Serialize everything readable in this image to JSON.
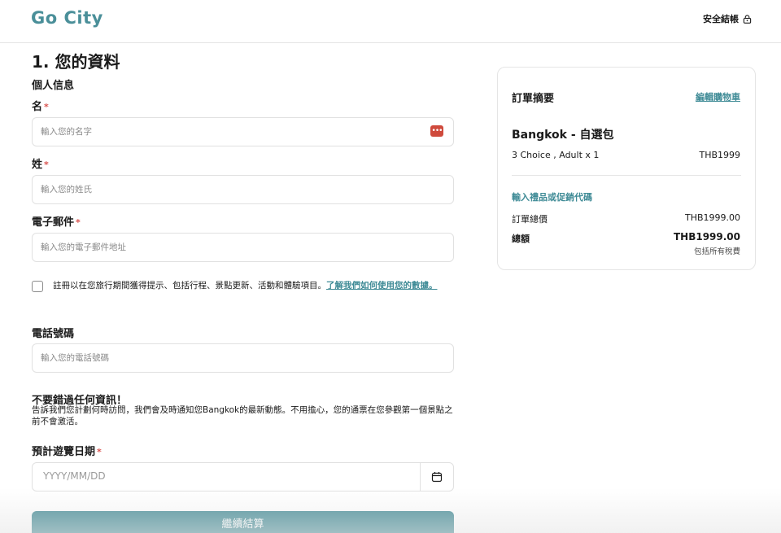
{
  "header": {
    "logo": "Go City",
    "secure_checkout": "安全結帳"
  },
  "form": {
    "page_title": "1. 您的資料",
    "section_title": "個人信息",
    "first_name": {
      "label": "名",
      "required_mark": "*",
      "placeholder": "輸入您的名字"
    },
    "last_name": {
      "label": "姓",
      "required_mark": "*",
      "placeholder": "輸入您的姓氏"
    },
    "email": {
      "label": "電子郵件",
      "required_mark": "*",
      "placeholder": "輸入您的電子郵件地址"
    },
    "consent": {
      "text": "註冊以在您旅行期間獲得提示、包括行程、景點更新、活動和體驗項目。",
      "link": "了解我們如何使用您的數據。"
    },
    "phone": {
      "label": "電話號碼",
      "placeholder": "輸入您的電話號碼"
    },
    "info": {
      "heading": "不要錯過任何資訊！",
      "body": "告訴我們您計劃何時訪問，我們會及時通知您Bangkok的最新動態。不用擔心，您的通票在您參觀第一個景點之前不會激活。"
    },
    "visit_date": {
      "label": "預計遊覽日期",
      "required_mark": "*",
      "placeholder": "YYYY/MM/DD"
    },
    "continue_button": "繼續結算"
  },
  "summary": {
    "title": "訂單摘要",
    "edit_cart": "編輯購物車",
    "product_name": "Bangkok - 自選包",
    "product_detail": "3 Choice , Adult x 1",
    "product_price": "THB1999",
    "promo_link": "輸入禮品或促銷代碼",
    "subtotal_label": "訂單總價",
    "subtotal_value": "THB1999.00",
    "total_label": "總額",
    "total_value": "THB1999.00",
    "tax_note": "包括所有稅費"
  },
  "colors": {
    "brand": "#4a8f99",
    "link": "#3f8b96",
    "required": "#d9534f",
    "password_manager": "#cf4a3c"
  },
  "icons": {
    "secure": "lock-icon",
    "password_manager": "password-manager-icon",
    "calendar": "calendar-icon"
  }
}
